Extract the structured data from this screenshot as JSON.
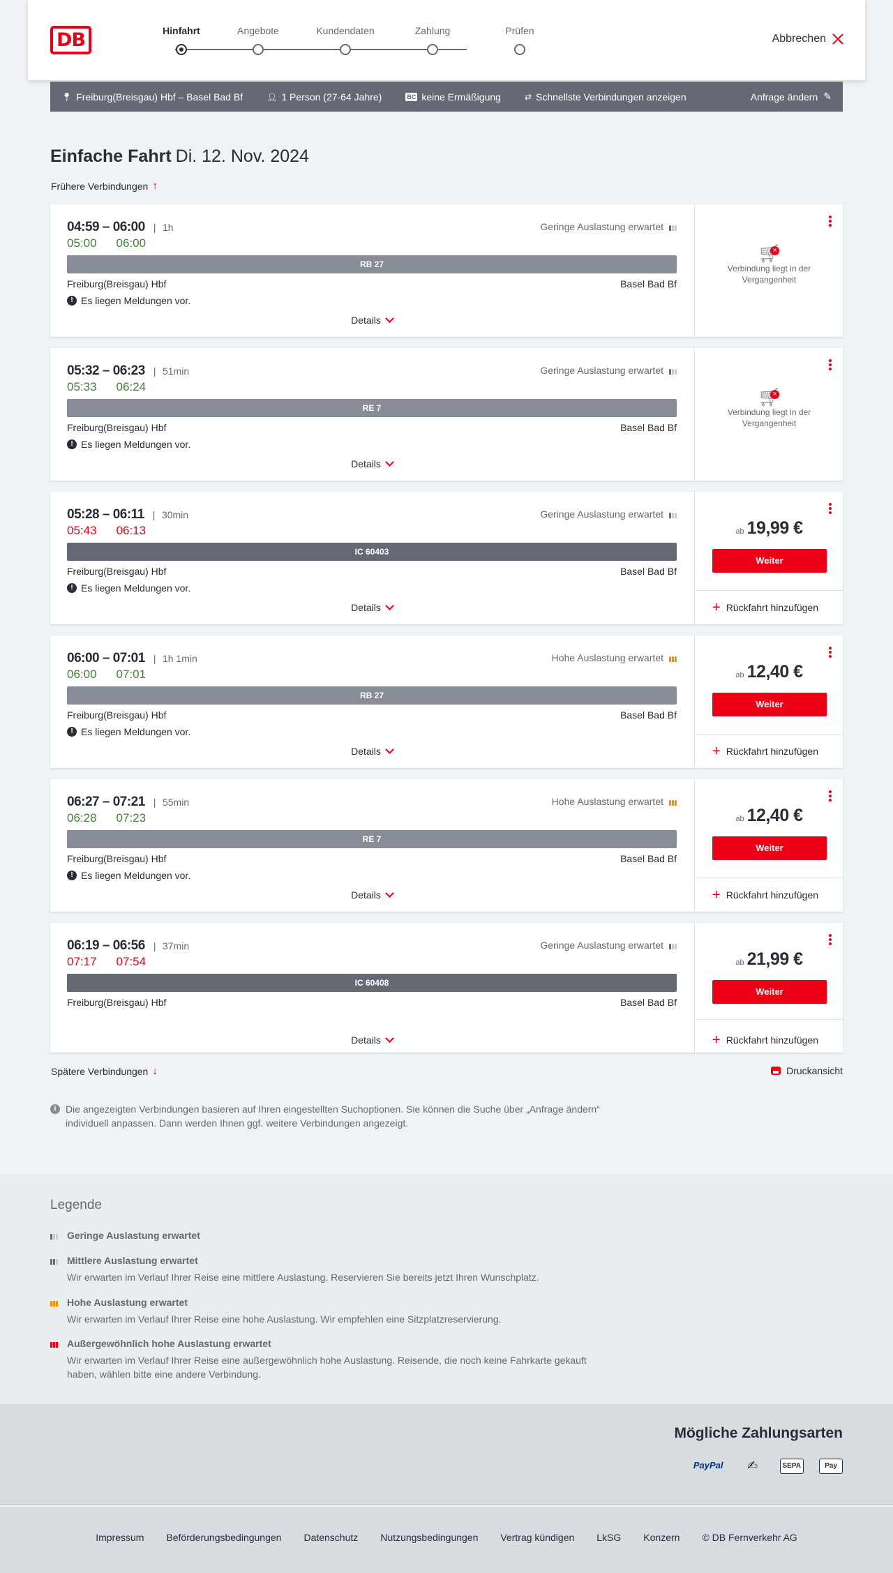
{
  "header": {
    "logo": "DB",
    "steps": [
      {
        "label": "Hinfahrt"
      },
      {
        "label": "Angebote"
      },
      {
        "label": "Kundendaten"
      },
      {
        "label": "Zahlung"
      },
      {
        "label": "Prüfen"
      }
    ],
    "cancel_label": "Abbrechen"
  },
  "searchbar": {
    "route": "Freiburg(Breisgau) Hbf – Basel Bad Bf",
    "travelers": "1 Person (27-64 Jahre)",
    "discount_badge": "BC",
    "discount": "keine Ermäßigung",
    "fastest": "Schnellste Verbindungen anzeigen",
    "change": "Anfrage ändern"
  },
  "title": {
    "main": "Einfache Fahrt",
    "date": "Di. 12. Nov. 2024"
  },
  "earlier": "Frühere Verbindungen",
  "later": "Spätere Verbindungen",
  "print": "Druckansicht",
  "common": {
    "details": "Details",
    "past_line1": "Verbindung liegt in der",
    "past_line2": "Vergangenheit",
    "price_prefix": "ab",
    "weiter": "Weiter",
    "return": "Rückfahrt hinzufügen",
    "message": "Es liegen Meldungen vor."
  },
  "connections": [
    {
      "times": "04:59 – 06:00",
      "duration": "1h",
      "rt_dep": "05:00",
      "rt_arr": "06:00",
      "load": "Geringe Auslastung erwartet",
      "train": "RB 27",
      "from": "Freiburg(Breisgau) Hbf",
      "to": "Basel Bad Bf"
    },
    {
      "times": "05:32 – 06:23",
      "duration": "51min",
      "rt_dep": "05:33",
      "rt_arr": "06:24",
      "load": "Geringe Auslastung erwartet",
      "train": "RE 7",
      "from": "Freiburg(Breisgau) Hbf",
      "to": "Basel Bad Bf"
    },
    {
      "times": "05:28 – 06:11",
      "duration": "30min",
      "rt_dep": "05:43",
      "rt_arr": "06:13",
      "load": "Geringe Auslastung erwartet",
      "train": "IC 60403",
      "from": "Freiburg(Breisgau) Hbf",
      "to": "Basel Bad Bf",
      "price": "19,99 €"
    },
    {
      "times": "06:00 – 07:01",
      "duration": "1h 1min",
      "rt_dep": "06:00",
      "rt_arr": "07:01",
      "load": "Hohe Auslastung erwartet",
      "train": "RB 27",
      "from": "Freiburg(Breisgau) Hbf",
      "to": "Basel Bad Bf",
      "price": "12,40 €"
    },
    {
      "times": "06:27 – 07:21",
      "duration": "55min",
      "rt_dep": "06:28",
      "rt_arr": "07:23",
      "load": "Hohe Auslastung erwartet",
      "train": "RE 7",
      "from": "Freiburg(Breisgau) Hbf",
      "to": "Basel Bad Bf",
      "price": "12,40 €"
    },
    {
      "times": "06:19 – 06:56",
      "duration": "37min",
      "rt_dep": "07:17",
      "rt_arr": "07:54",
      "load": "Geringe Auslastung erwartet",
      "train": "IC 60408",
      "from": "Freiburg(Breisgau) Hbf",
      "to": "Basel Bad Bf",
      "price": "21,99 €"
    }
  ],
  "info": "Die angezeigten Verbindungen basieren auf Ihren eingestellten Suchoptionen. Sie können die Suche über „Anfrage ändern“ individuell anpassen. Dann werden Ihnen ggf. weitere Verbindungen angezeigt.",
  "legend": {
    "title": "Legende",
    "items": [
      {
        "head": "Geringe Auslastung erwartet",
        "text": ""
      },
      {
        "head": "Mittlere Auslastung erwartet",
        "text": "Wir erwarten im Verlauf Ihrer Reise eine mittlere Auslastung. Reservieren Sie bereits jetzt Ihren Wunschplatz."
      },
      {
        "head": "Hohe Auslastung erwartet",
        "text": "Wir erwarten im Verlauf Ihrer Reise eine hohe Auslastung. Wir empfehlen eine Sitzplatzreservierung."
      },
      {
        "head": "Außergewöhnlich hohe Auslastung erwartet",
        "text": "Wir erwarten im Verlauf Ihrer Reise eine außergewöhnlich hohe Auslastung. Reisende, die noch keine Fahrkarte gekauft haben, wählen bitte eine andere Verbindung."
      }
    ]
  },
  "payment": {
    "title": "Mögliche Zahlungsarten",
    "methods": [
      "PayPal",
      "SEPA",
      "Pay"
    ]
  },
  "footer": {
    "links": [
      "Impressum",
      "Beförderungsbedingungen",
      "Datenschutz",
      "Nutzungsbedingungen",
      "Vertrag kündigen",
      "LkSG",
      "Konzern",
      "© DB Fernverkehr AG"
    ]
  },
  "colors": {
    "brand_red": "#ec0016",
    "on_time_green": "#408335",
    "load_high": "#f39200",
    "train_bar": "#878c96",
    "train_bar_ic": "#646973"
  }
}
